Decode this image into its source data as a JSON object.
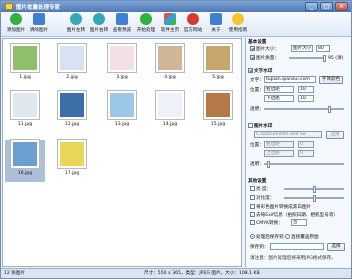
{
  "window": {
    "title": "图片批量处理专家",
    "buttons": [
      "_",
      "□",
      "×"
    ]
  },
  "toolbar": [
    {
      "label": "添加图片",
      "icon": "add-image-icon",
      "color": "green"
    },
    {
      "label": "清除图片",
      "icon": "clear-images-icon",
      "color": "blue"
    },
    {
      "label": "图片左转",
      "icon": "rotate-left-icon",
      "color": "teal"
    },
    {
      "label": "图片右转",
      "icon": "rotate-right-icon",
      "color": "teal"
    },
    {
      "label": "查看预览",
      "icon": "preview-icon",
      "color": "blue"
    },
    {
      "label": "开始处理",
      "icon": "start-process-icon",
      "color": "green"
    },
    {
      "label": "软件主页",
      "icon": "homepage-icon",
      "color": "mix"
    },
    {
      "label": "官方网站",
      "icon": "website-icon",
      "color": "red"
    },
    {
      "label": "关于",
      "icon": "info-icon",
      "color": "blue"
    },
    {
      "label": "使用指南",
      "icon": "help-icon",
      "color": "yellow"
    }
  ],
  "images": [
    {
      "name": "1.jpg",
      "color": "#8fbf6a"
    },
    {
      "name": "2.jpg",
      "color": "#d7e3f2"
    },
    {
      "name": "3.jpg",
      "color": "#f3e0e6"
    },
    {
      "name": "4.jpg",
      "color": "#d1b597"
    },
    {
      "name": "5.jpg",
      "color": "#c9a56e"
    },
    {
      "name": "11.jpg",
      "color": "#dfe7ef"
    },
    {
      "name": "12.jpg",
      "color": "#3c6fa8"
    },
    {
      "name": "13.jpg",
      "color": "#9bc7e8"
    },
    {
      "name": "14.jpg",
      "color": "#eef2f6"
    },
    {
      "name": "15.jpg",
      "color": "#b77848"
    },
    {
      "name": "16.jpg",
      "color": "#6b9fd0"
    },
    {
      "name": "17.jpg",
      "color": "#e9d55a"
    }
  ],
  "right_panel": {
    "basic_title": "基本设置",
    "resize_label": "图片大小：",
    "resize_value": "图片大小：",
    "resize_unit": "80",
    "quality_label": "图片质量：",
    "quality_value": "95 (清)",
    "text_wm_title": "文字水印",
    "text_label": "文字：",
    "text_value": "tupian.qianzui.com",
    "font_btn": "字体颜色",
    "pos_label": "位置：",
    "pos_h": "右边距",
    "pos_h_val": "10",
    "pos_v": "下边距",
    "pos_v_val": "10",
    "opacity_label": "透明：",
    "image_wm_title": "图片水印",
    "image_path": "C:\\Documents and Se",
    "image_btn": "选择",
    "image_pos_label": "位置：",
    "image_pos_h": "右边距",
    "image_pos_h_val": "0",
    "image_pos_v": "上边距",
    "image_pos_v_val": "0",
    "image_opacity_label": "透明：",
    "other_title": "其他设置",
    "brightness": "亮  度：",
    "contrast": "对比度：",
    "opt1": "将彩色图片转换成黑白图片",
    "opt2": "去除Exif信息（拍照日期、相机型号等）",
    "opt3": "CMYK转换：",
    "cmyk_value": "否",
    "save_original": "处理后保存到",
    "save_overwrite": "直接覆盖原图",
    "save_label": "保存到：",
    "save_btn": "选择",
    "note": "请注意：图片处理后将采用JPG格式保存。"
  },
  "status": {
    "left": "12 张图片",
    "right": "尺寸：550 x 365，类型：JPEG 图片，大小：108.1 KB"
  }
}
